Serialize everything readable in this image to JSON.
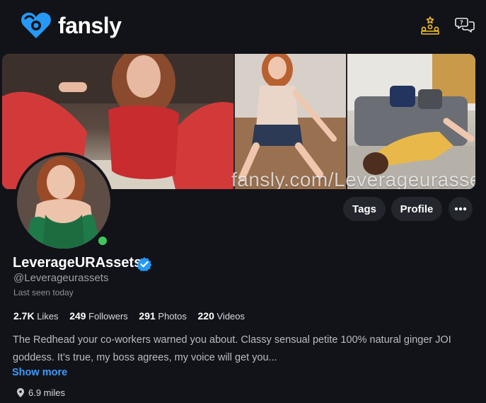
{
  "nav": {
    "brand": "fansly",
    "icons": [
      "leaderboard-icon",
      "chat-help-icon"
    ],
    "accent_color": "#f7c22b",
    "brand_color": "#2699f7"
  },
  "banner": {
    "watermark": "fansly.com/Leverageurasse"
  },
  "actions": {
    "tags_label": "Tags",
    "profile_label": "Profile",
    "more_label": "•••"
  },
  "profile": {
    "display_name": "LeverageURAssets",
    "handle": "@Leverageurassets",
    "last_seen": "Last seen today",
    "online": true,
    "verified": true
  },
  "stats": [
    {
      "value": "2.7K",
      "label": "Likes"
    },
    {
      "value": "249",
      "label": "Followers"
    },
    {
      "value": "291",
      "label": "Photos"
    },
    {
      "value": "220",
      "label": "Videos"
    }
  ],
  "bio": {
    "text": "The Redhead your co-workers warned you about. Classy sensual petite 100% natural ginger JOI goddess. It’s true, my boss agrees, my voice will get you...",
    "show_more_label": "Show more"
  },
  "location": {
    "distance": "6.9 miles"
  }
}
